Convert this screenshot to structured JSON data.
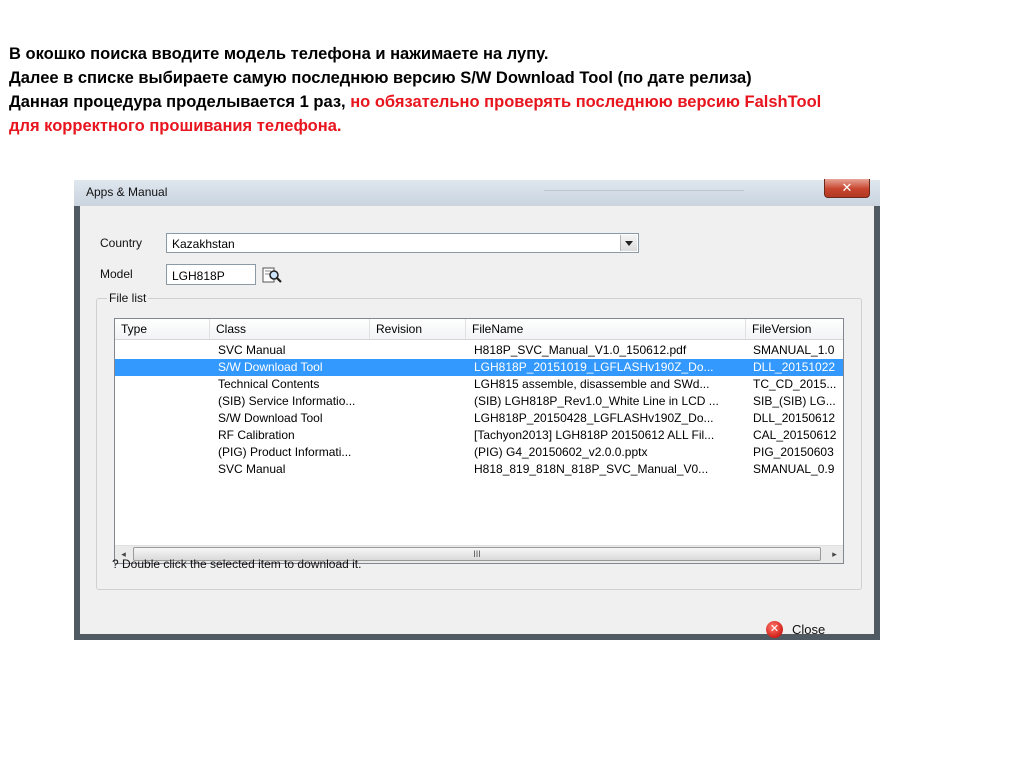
{
  "instructions": {
    "line1": "В окошко поиска вводите модель телефона и нажимаете на лупу.",
    "line2": "Далее в списке выбираете самую последнюю версию S/W Download Tool (по дате релиза)",
    "line3_black": "Данная процедура проделывается 1 раз, ",
    "line3_red": "но обязательно проверять последнюю версию FalshTool",
    "line4_red": "для корректного прошивания телефона.",
    "accent_color": "#e8141e"
  },
  "window": {
    "title": "Apps & Manual",
    "close_glyph": "✕"
  },
  "form": {
    "country_label": "Country",
    "country_value": "Kazakhstan",
    "model_label": "Model",
    "model_value": "LGH818P",
    "search_icon": "magnifier-icon"
  },
  "file_list": {
    "group_label": "File list",
    "columns": [
      "Type",
      "Class",
      "Revision",
      "FileName",
      "FileVersion"
    ],
    "rows": [
      {
        "type": "",
        "class": "SVC Manual",
        "revision": "",
        "filename": "H818P_SVC_Manual_V1.0_150612.pdf",
        "fileversion": "SMANUAL_1.0"
      },
      {
        "type": "",
        "class": "S/W Download Tool",
        "revision": "",
        "filename": "LGH818P_20151019_LGFLASHv190Z_Do...",
        "fileversion": "DLL_20151022"
      },
      {
        "type": "",
        "class": "Technical Contents",
        "revision": "",
        "filename": "LGH815 assemble, disassemble and SWd...",
        "fileversion": "TC_CD_2015..."
      },
      {
        "type": "",
        "class": "(SIB) Service Informatio...",
        "revision": "",
        "filename": "(SIB) LGH818P_Rev1.0_White Line in LCD ...",
        "fileversion": "SIB_(SIB) LG..."
      },
      {
        "type": "",
        "class": "S/W Download Tool",
        "revision": "",
        "filename": "LGH818P_20150428_LGFLASHv190Z_Do...",
        "fileversion": "DLL_20150612"
      },
      {
        "type": "",
        "class": "RF Calibration",
        "revision": "",
        "filename": "[Tachyon2013] LGH818P 20150612 ALL Fil...",
        "fileversion": "CAL_20150612"
      },
      {
        "type": "",
        "class": "(PIG) Product Informati...",
        "revision": "",
        "filename": "(PIG) G4_20150602_v2.0.0.pptx",
        "fileversion": "PIG_20150603"
      },
      {
        "type": "",
        "class": "SVC Manual",
        "revision": "",
        "filename": "H818_819_818N_818P_SVC_Manual_V0...",
        "fileversion": "SMANUAL_0.9"
      }
    ],
    "selected_row_index": 1,
    "selection_color": "#3399ff",
    "scroll_left_glyph": "◂",
    "scroll_right_glyph": "▸",
    "scroll_grip_glyph": "III"
  },
  "hint_text": "? Double click the selected item to download it.",
  "close_button_label": "Close",
  "close_button_glyph": "✕"
}
